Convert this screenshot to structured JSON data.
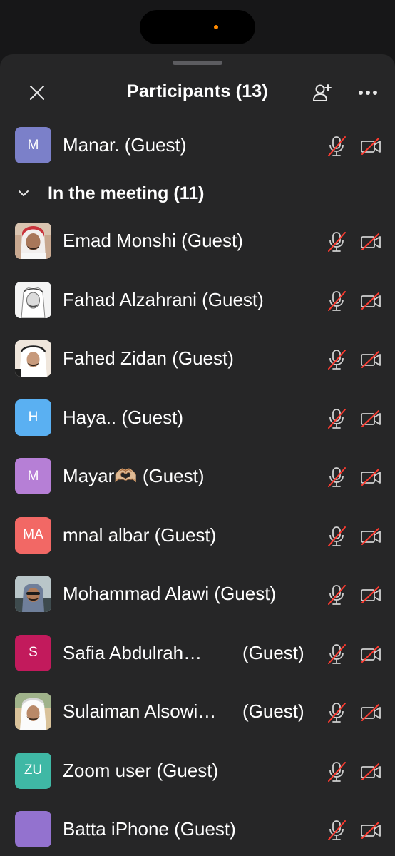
{
  "header": {
    "title": "Participants (13)"
  },
  "waiting": {
    "initials": "M",
    "name": "Manar. (Guest)",
    "color": "#7b80c9"
  },
  "section": {
    "label": "In the meeting (11)"
  },
  "participants": [
    {
      "name": "Emad Monshi (Guest)",
      "avatar_type": "photo"
    },
    {
      "name": "Fahad Alzahrani (Guest)",
      "avatar_type": "photo"
    },
    {
      "name": "Fahed Zidan (Guest)",
      "avatar_type": "photo"
    },
    {
      "name": "Haya.. (Guest)",
      "initials": "H",
      "color": "#5ab0f2"
    },
    {
      "name": "Mayar🫶🏼 (Guest)",
      "initials": "M",
      "color": "#b67fd6"
    },
    {
      "name": "mnal albar (Guest)",
      "initials": "MA",
      "color": "#f26865"
    },
    {
      "name": "Mohammad Alawi (Guest)",
      "avatar_type": "photo"
    },
    {
      "name": "Safia Abdulrah…",
      "guest": "(Guest)",
      "initials": "S",
      "color": "#c21a5c"
    },
    {
      "name": "Sulaiman Alsowi…",
      "guest": "(Guest)",
      "avatar_type": "photo"
    },
    {
      "name": "Zoom user (Guest)",
      "initials": "ZU",
      "color": "#3fb8a5"
    },
    {
      "name": "Batta iPhone (Guest)",
      "initials": "",
      "color": "#9372cf"
    }
  ],
  "icons": {
    "close": "close-icon",
    "invite": "add-participant-icon",
    "more": "more-icon",
    "mic_muted": "mic-muted-icon",
    "video_off": "video-off-icon",
    "chevron": "chevron-down-icon"
  },
  "colors": {
    "sheet_bg": "#262627",
    "muted_red": "#ff3b30"
  }
}
